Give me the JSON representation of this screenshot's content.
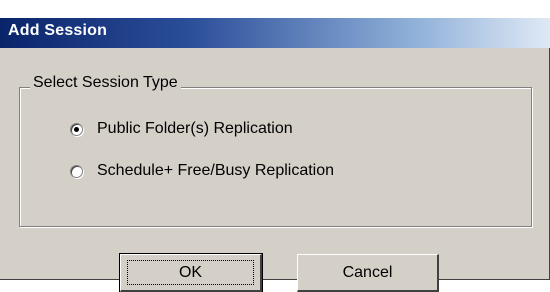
{
  "window": {
    "title": "Add Session"
  },
  "session_type_group": {
    "legend": "Select Session Type",
    "options": [
      {
        "label": "Public Folder(s) Replication",
        "selected": true
      },
      {
        "label": "Schedule+ Free/Busy Replication",
        "selected": false
      }
    ]
  },
  "buttons": {
    "ok_label": "OK",
    "cancel_label": "Cancel"
  },
  "colors": {
    "face": "#d4d0c8",
    "title_start": "#0a246a",
    "title_end": "#dfe9f5",
    "title_text": "#ffffff"
  }
}
